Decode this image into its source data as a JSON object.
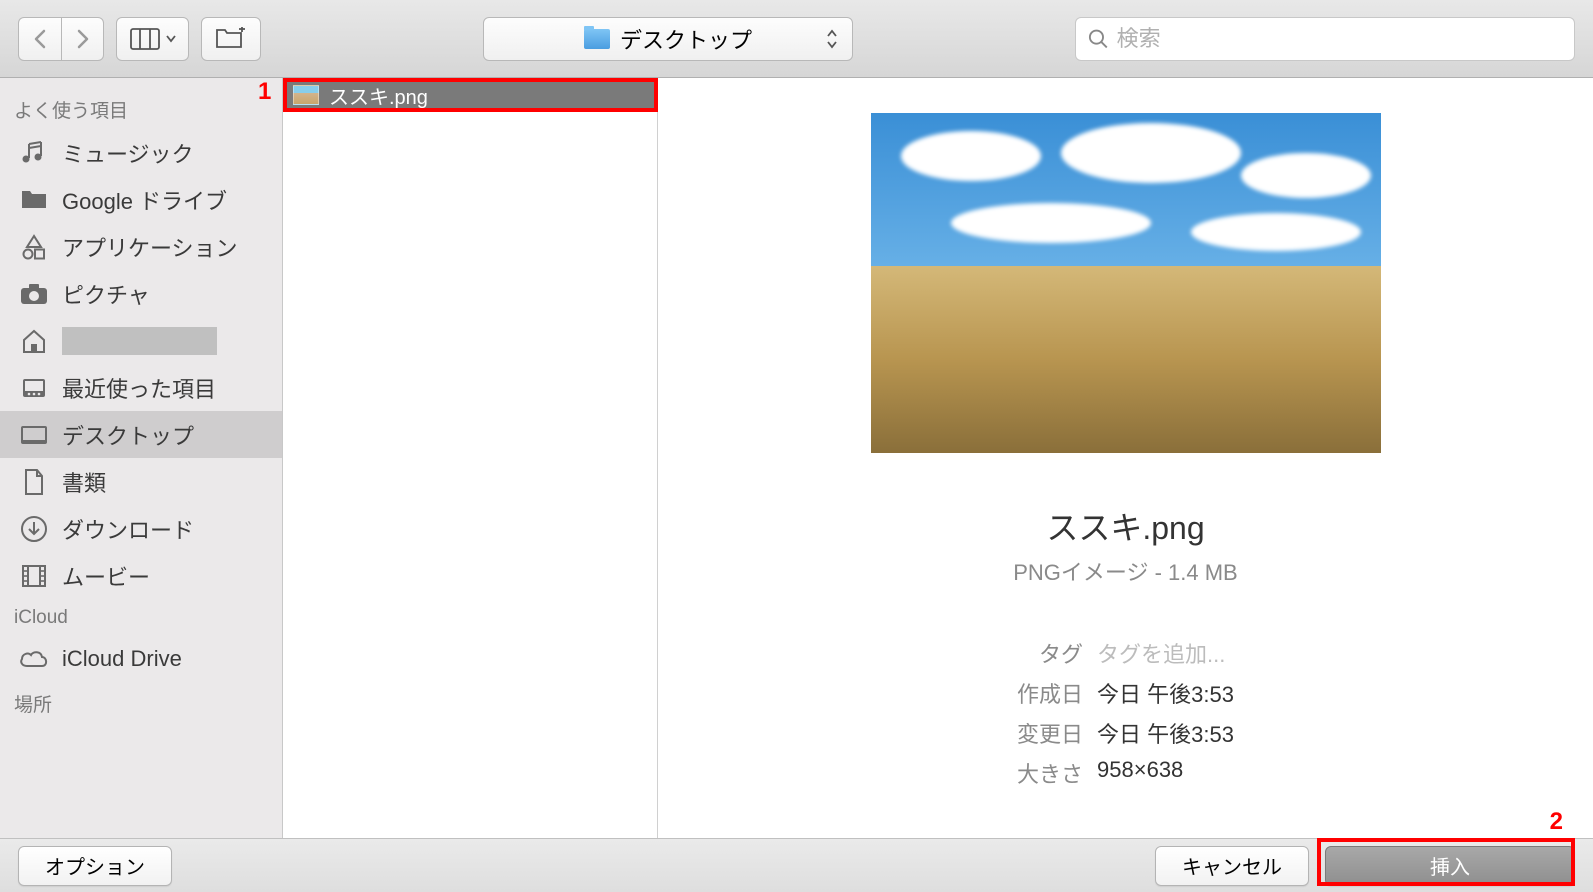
{
  "toolbar": {
    "location": "デスクトップ",
    "search_placeholder": "検索"
  },
  "sidebar": {
    "sections": [
      {
        "header": "よく使う項目",
        "items": [
          {
            "icon": "music",
            "label": "ミュージック"
          },
          {
            "icon": "folder",
            "label": "Google ドライブ"
          },
          {
            "icon": "apps",
            "label": "アプリケーション"
          },
          {
            "icon": "camera",
            "label": "ピクチャ"
          },
          {
            "icon": "home",
            "label": "",
            "redacted": true
          },
          {
            "icon": "recent",
            "label": "最近使った項目"
          },
          {
            "icon": "desktop",
            "label": "デスクトップ",
            "selected": true
          },
          {
            "icon": "document",
            "label": "書類"
          },
          {
            "icon": "download",
            "label": "ダウンロード"
          },
          {
            "icon": "movie",
            "label": "ムービー"
          }
        ]
      },
      {
        "header": "iCloud",
        "items": [
          {
            "icon": "cloud",
            "label": "iCloud Drive"
          }
        ]
      },
      {
        "header": "場所",
        "items": []
      }
    ]
  },
  "files": [
    {
      "name": "ススキ.png",
      "selected": true
    }
  ],
  "preview": {
    "title": "ススキ.png",
    "subtitle": "PNGイメージ - 1.4 MB",
    "meta": [
      {
        "label": "タグ",
        "value": "タグを追加...",
        "placeholder": true
      },
      {
        "label": "作成日",
        "value": "今日 午後3:53"
      },
      {
        "label": "変更日",
        "value": "今日 午後3:53"
      },
      {
        "label": "大きさ",
        "value": "958×638"
      }
    ]
  },
  "buttons": {
    "options": "オプション",
    "cancel": "キャンセル",
    "insert": "挿入"
  },
  "callouts": {
    "one": "1",
    "two": "2"
  }
}
